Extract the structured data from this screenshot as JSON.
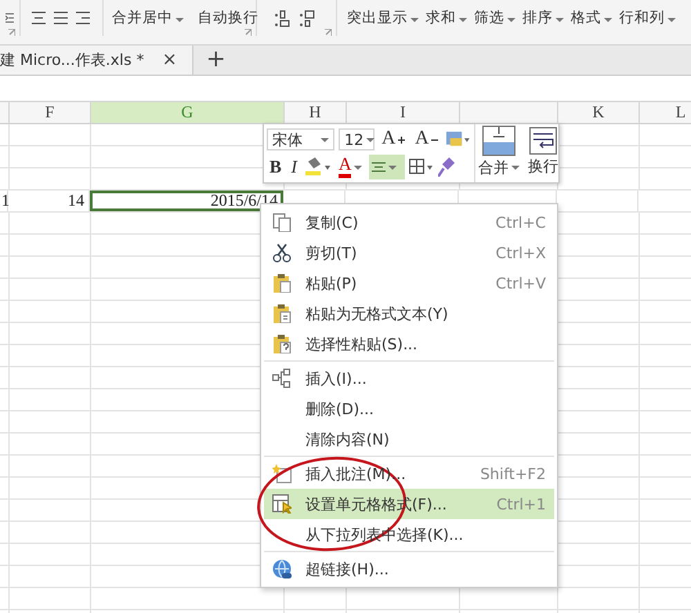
{
  "ribbon": {
    "alignment_buttons": [
      {
        "label": "合并居中",
        "dropdown": true
      },
      {
        "label": "自动换行",
        "dropdown": false
      }
    ],
    "data_buttons": [
      {
        "label": "突出显示",
        "dropdown": true
      },
      {
        "label": "求和",
        "dropdown": true
      },
      {
        "label": "筛选",
        "dropdown": true
      },
      {
        "label": "排序",
        "dropdown": true
      },
      {
        "label": "格式",
        "dropdown": true
      },
      {
        "label": "行和列",
        "dropdown": true
      }
    ]
  },
  "document_tab": {
    "label": "建 Micro...作表.xls *",
    "close": "×",
    "new_tab": "+"
  },
  "sheet": {
    "columns": [
      {
        "selected": false
      },
      {
        "label": "F",
        "selected": false
      },
      {
        "label": "G",
        "selected": true
      },
      {
        "label": "H",
        "selected": false
      },
      {
        "label": "I",
        "selected": false
      },
      {
        "selected": false
      },
      {
        "label": "K",
        "selected": false
      },
      {
        "label": "L",
        "selected": false
      }
    ],
    "rows": [
      {
        "cells": [
          {
            "text": "1",
            "selected": false
          },
          {
            "text": "14",
            "selected": false
          },
          {
            "text": "2015/6/14",
            "selected": true
          }
        ]
      }
    ]
  },
  "mini_toolbar": {
    "font": "宋体",
    "size": "12",
    "grow": "A",
    "shrink": "A",
    "bold": "B",
    "italic": "I",
    "font_color": "A",
    "align_selected": true,
    "merge": "合并",
    "wrap": "换行"
  },
  "context_menu": {
    "items": [
      {
        "kind": "copy",
        "label": "复制(C)",
        "shortcut": "Ctrl+C",
        "selected": false,
        "circled": false
      },
      {
        "kind": "cut",
        "label": "剪切(T)",
        "shortcut": "Ctrl+X",
        "selected": false,
        "circled": false
      },
      {
        "kind": "paste",
        "label": "粘贴(P)",
        "shortcut": "Ctrl+V",
        "selected": false,
        "circled": false
      },
      {
        "kind": "paste-text",
        "label": "粘贴为无格式文本(Y)",
        "selected": false,
        "circled": false
      },
      {
        "kind": "paste-special",
        "label": "选择性粘贴(S)...",
        "selected": false,
        "circled": false
      },
      {
        "kind": "separator"
      },
      {
        "kind": "insert",
        "label": "插入(I)...",
        "selected": false,
        "circled": false
      },
      {
        "kind": "plain",
        "label": "删除(D)...",
        "selected": false,
        "circled": false
      },
      {
        "kind": "plain",
        "label": "清除内容(N)",
        "selected": false,
        "circled": false
      },
      {
        "kind": "separator"
      },
      {
        "kind": "comment",
        "label": "插入批注(M)...",
        "shortcut": "Shift+F2",
        "selected": false,
        "circled": false
      },
      {
        "kind": "format",
        "label": "设置单元格格式(F)...",
        "shortcut": "Ctrl+1",
        "selected": true,
        "circled": true
      },
      {
        "kind": "plain",
        "label": "从下拉列表中选择(K)...",
        "selected": false,
        "circled": false
      },
      {
        "kind": "separator"
      },
      {
        "kind": "link",
        "label": "超链接(H)...",
        "selected": false,
        "circled": false
      }
    ]
  }
}
